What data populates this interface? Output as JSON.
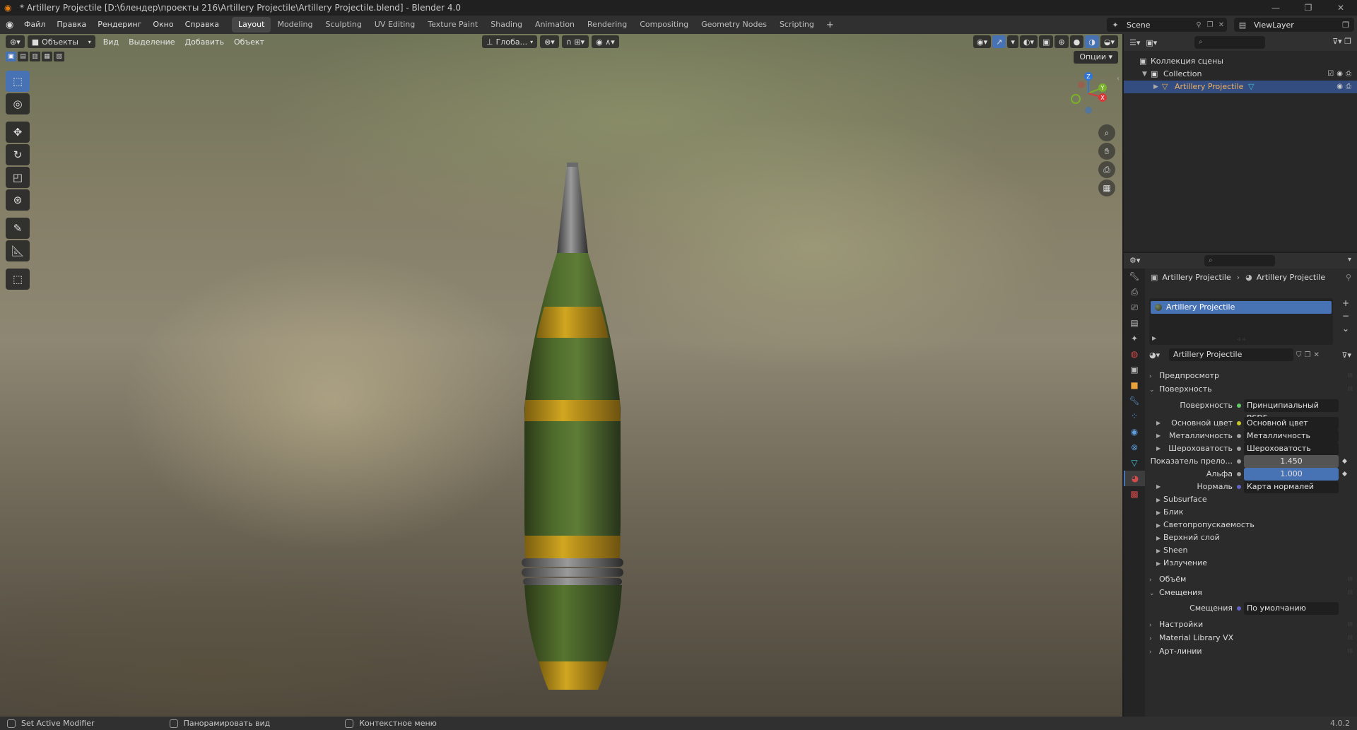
{
  "window": {
    "title": "* Artillery Projectile [D:\\блендер\\проекты 216\\Artillery Projectile\\Artillery Projectile.blend] - Blender 4.0",
    "minimize": "—",
    "maximize": "❐",
    "close": "✕"
  },
  "menu": [
    "Файл",
    "Правка",
    "Рендеринг",
    "Окно",
    "Справка"
  ],
  "workspaces": [
    "Layout",
    "Modeling",
    "Sculpting",
    "UV Editing",
    "Texture Paint",
    "Shading",
    "Animation",
    "Rendering",
    "Compositing",
    "Geometry Nodes",
    "Scripting"
  ],
  "active_workspace": "Layout",
  "scene": {
    "name": "Scene"
  },
  "viewlayer": {
    "name": "ViewLayer"
  },
  "viewport": {
    "mode": "Объекты",
    "menus": [
      "Вид",
      "Выделение",
      "Добавить",
      "Объект"
    ],
    "orientation": "Глоба...",
    "options": "Опции",
    "gizmo_axes": [
      "X",
      "Y",
      "Z"
    ]
  },
  "outliner": {
    "scene_collection": "Коллекция сцены",
    "collection": "Collection",
    "object": "Artillery Projectile"
  },
  "properties": {
    "breadcrumb_object": "Artillery Projectile",
    "breadcrumb_material": "Artillery Projectile",
    "slot": "Artillery Projectile",
    "material_name": "Artillery Projectile",
    "panels": {
      "preview": "Предпросмотр",
      "surface": "Поверхность",
      "volume": "Объём",
      "displacement": "Смещения",
      "settings": "Настройки",
      "material_library": "Material Library VX",
      "line_art": "Арт-линии"
    },
    "surface_rows": [
      {
        "label": "Поверхность",
        "value": "Принципиальный BSDF",
        "socket": "#63c763"
      },
      {
        "label": "Основной цвет",
        "value": "Основной цвет",
        "socket": "#c7c729"
      },
      {
        "label": "Металличность",
        "value": "Металличность",
        "socket": "#a1a1a1"
      },
      {
        "label": "Шероховатость",
        "value": "Шероховатость",
        "socket": "#a1a1a1"
      },
      {
        "label": "Показатель прело...",
        "value": "1.450",
        "socket": "#a1a1a1"
      },
      {
        "label": "Альфа",
        "value": "1.000",
        "socket": "#a1a1a1"
      },
      {
        "label": "Нормаль",
        "value": "Карта нормалей",
        "socket": "#6363c7"
      }
    ],
    "sub_panels": [
      "Subsurface",
      "Блик",
      "Светопропускаемость",
      "Верхний слой",
      "Sheen",
      "Излучение"
    ],
    "displacement_row": {
      "label": "Смещения",
      "value": "По умолчанию",
      "socket": "#6363c7"
    }
  },
  "statusbar": {
    "left": "Set Active Modifier",
    "middle": "Панорамировать вид",
    "right": "Контекстное меню",
    "version": "4.0.2"
  },
  "colors": {
    "accent": "#4772b3",
    "blender_orange": "#e87d0d",
    "projectile_green": "#4e6b2c",
    "projectile_yellow": "#d1a620"
  }
}
